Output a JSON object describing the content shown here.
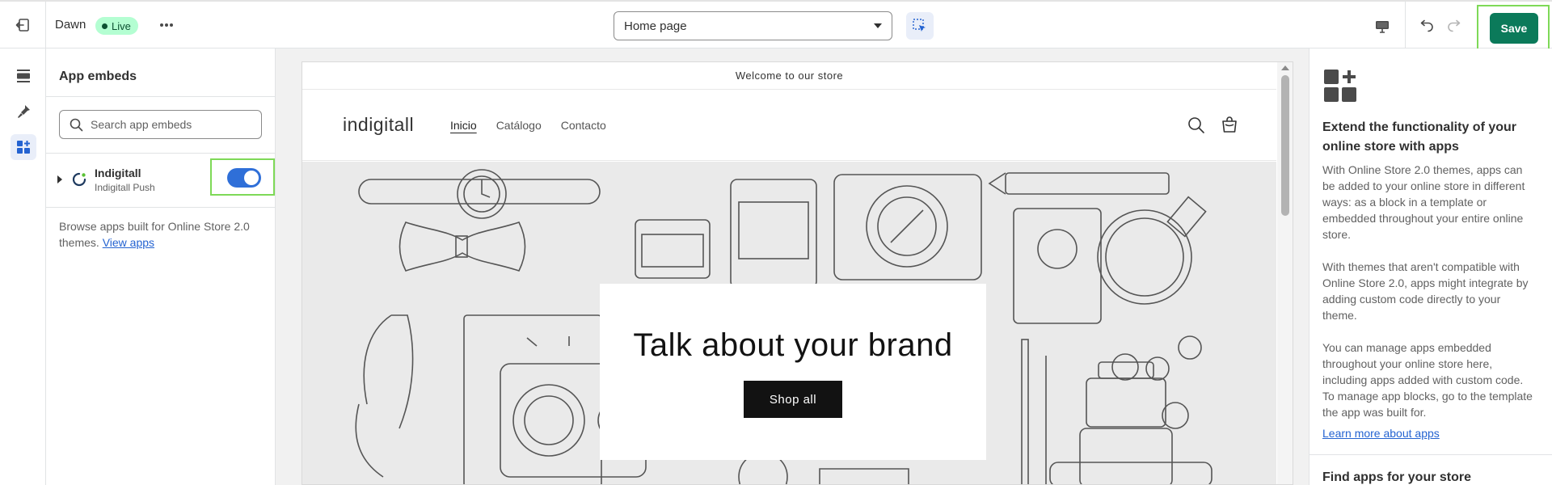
{
  "topbar": {
    "theme_name": "Dawn",
    "live_label": "Live",
    "page_selector_value": "Home page",
    "save_label": "Save"
  },
  "sidebar": {
    "title": "App embeds",
    "search_placeholder": "Search app embeds",
    "apps": [
      {
        "name": "Indigitall",
        "subtitle": "Indigitall Push",
        "enabled": true
      }
    ],
    "browse_text": "Browse apps built for Online Store 2.0 themes. ",
    "browse_link": "View apps"
  },
  "preview": {
    "announcement": "Welcome to our store",
    "store_name": "indigitall",
    "nav": [
      "Inicio",
      "Catálogo",
      "Contacto"
    ],
    "hero_title": "Talk about your brand",
    "hero_button": "Shop all"
  },
  "right_panel": {
    "title": "Extend the functionality of your online store with apps",
    "paragraphs": [
      "With Online Store 2.0 themes, apps can be added to your online store in different ways: as a block in a template or embedded throughout your entire online store.",
      "With themes that aren't compatible with Online Store 2.0, apps might integrate by adding custom code directly to your theme.",
      "You can manage apps embedded throughout your online store here, including apps added with custom code. To manage app blocks, go to the template the app was built for."
    ],
    "learn_more": "Learn more about apps",
    "section2_title": "Find apps for your store"
  },
  "colors": {
    "save_green": "#0b7a5a",
    "toggle_blue": "#2f6fd8",
    "live_badge": "#b4fed2",
    "highlight": "#7ed957",
    "link_blue": "#2463d1"
  },
  "icons": [
    "exit-icon",
    "more-horizontal-icon",
    "chevron-down-icon",
    "select-cursor-icon",
    "desktop-icon",
    "undo-icon",
    "redo-icon",
    "sections-icon",
    "theme-settings-icon",
    "app-embeds-icon",
    "search-icon",
    "caret-right-icon",
    "indigitall-logo-icon",
    "cart-icon",
    "apps-grid-icon"
  ]
}
